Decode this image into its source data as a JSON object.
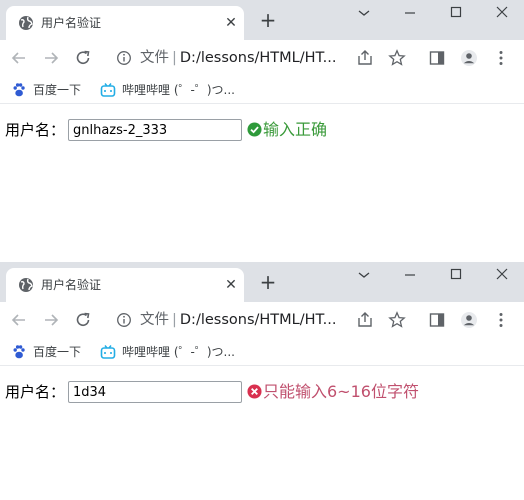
{
  "browser": {
    "tab_title": "用户名验证",
    "tab_close": "✕",
    "new_tab": "+",
    "omnibox_scheme": "文件",
    "omnibox_separator": "|",
    "omnibox_url": "D:/lessons/HTML/HT...",
    "bookmarks": [
      {
        "label": "百度一下",
        "icon": "baidu-paw-icon"
      },
      {
        "label": "哔哩哔哩 (゜-゜)つ...",
        "icon": "bilibili-tv-icon"
      }
    ]
  },
  "screens": [
    {
      "form": {
        "label": "用户名：",
        "value": "gnlhazs-2_333"
      },
      "validation": {
        "status": "success",
        "icon": "check-circle-icon",
        "message": "输入正确",
        "color": "#3a9a3a"
      }
    },
    {
      "form": {
        "label": "用户名：",
        "value": "1d34"
      },
      "validation": {
        "status": "error",
        "icon": "error-circle-icon",
        "message": "只能输入6~16位字符",
        "color": "#c0506e"
      }
    }
  ],
  "colors": {
    "tab_strip": "#dee1e6",
    "success": "#3a9a3a",
    "error": "#c0506e"
  }
}
